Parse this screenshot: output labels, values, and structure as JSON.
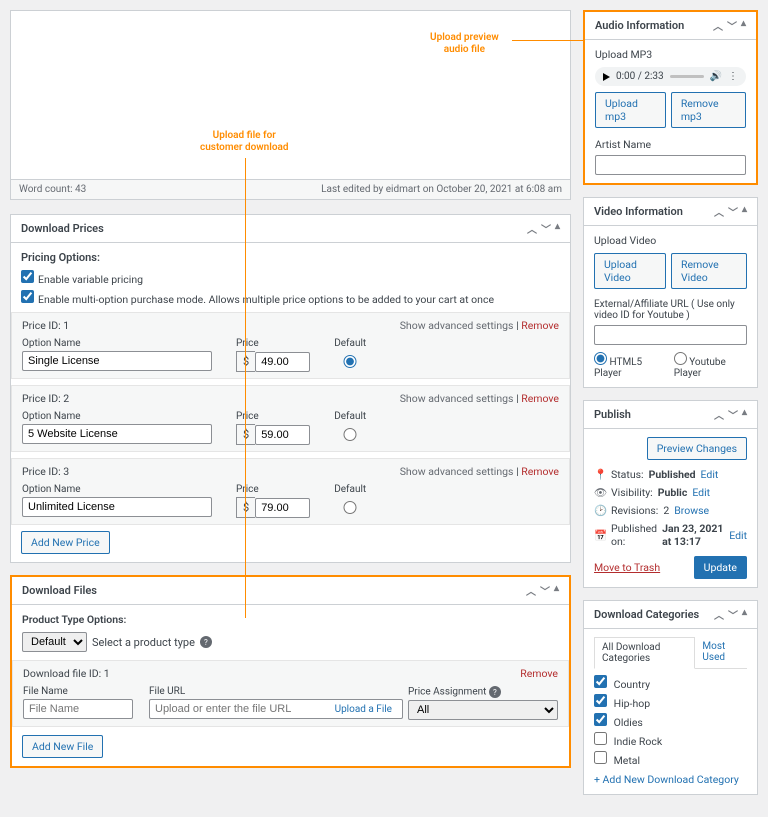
{
  "editor": {
    "word_count": "Word count: 43",
    "last_edit": "Last edited by eidmart on October 20, 2021 at 6:08 am"
  },
  "annot": {
    "a1": "Upload file for\ncustomer download",
    "a2": "Upload preview\naudio file"
  },
  "downloadPrices": {
    "title": "Download Prices",
    "pricing_options": "Pricing Options:",
    "cb1": "Enable variable pricing",
    "cb2": "Enable multi-option purchase mode. Allows multiple price options to be added to your cart at once",
    "adv": "Show advanced settings",
    "remove": "Remove",
    "lbl_option": "Option Name",
    "lbl_price": "Price",
    "lbl_default": "Default",
    "cur": "$",
    "rows": [
      {
        "id": "Price ID: 1",
        "name": "Single License",
        "price": "49.00",
        "def": true
      },
      {
        "id": "Price ID: 2",
        "name": "5 Website License",
        "price": "59.00",
        "def": false
      },
      {
        "id": "Price ID: 3",
        "name": "Unlimited License",
        "price": "79.00",
        "def": false
      }
    ],
    "add": "Add New Price"
  },
  "downloadFiles": {
    "title": "Download Files",
    "pt_label": "Product Type Options:",
    "pt_select": "Default",
    "pt_hint": "Select a product type",
    "fileid": "Download file ID: 1",
    "remove": "Remove",
    "lbl_name": "File Name",
    "lbl_url": "File URL",
    "lbl_pa": "Price Assignment",
    "ph_name": "File Name",
    "ph_url": "Upload or enter the file URL",
    "upload_link": "Upload a File",
    "pa_value": "All",
    "add": "Add New File"
  },
  "audio": {
    "title": "Audio Information",
    "upload": "Upload MP3",
    "time": "0:00 / 2:33",
    "b1": "Upload mp3",
    "b2": "Remove mp3",
    "artist": "Artist Name"
  },
  "video": {
    "title": "Video Information",
    "upload": "Upload Video",
    "b1": "Upload Video",
    "b2": "Remove Video",
    "ext": "External/Affiliate URL ( Use only video ID for Youtube )",
    "r1": "HTML5 Player",
    "r2": "Youtube Player"
  },
  "publish": {
    "title": "Publish",
    "preview": "Preview Changes",
    "status_l": "Status:",
    "status_v": "Published",
    "edit": "Edit",
    "vis_l": "Visibility:",
    "vis_v": "Public",
    "rev_l": "Revisions:",
    "rev_v": "2",
    "browse": "Browse",
    "pub_l": "Published on:",
    "pub_v": "Jan 23, 2021 at 13:17",
    "trash": "Move to Trash",
    "update": "Update"
  },
  "cats": {
    "title": "Download Categories",
    "tab1": "All Download Categories",
    "tab2": "Most Used",
    "items": [
      {
        "name": "Country",
        "c": true
      },
      {
        "name": "Hip-hop",
        "c": true
      },
      {
        "name": "Oldies",
        "c": true
      },
      {
        "name": "Indie Rock",
        "c": false
      },
      {
        "name": "Metal",
        "c": false
      }
    ],
    "add": "+ Add New Download Category"
  }
}
